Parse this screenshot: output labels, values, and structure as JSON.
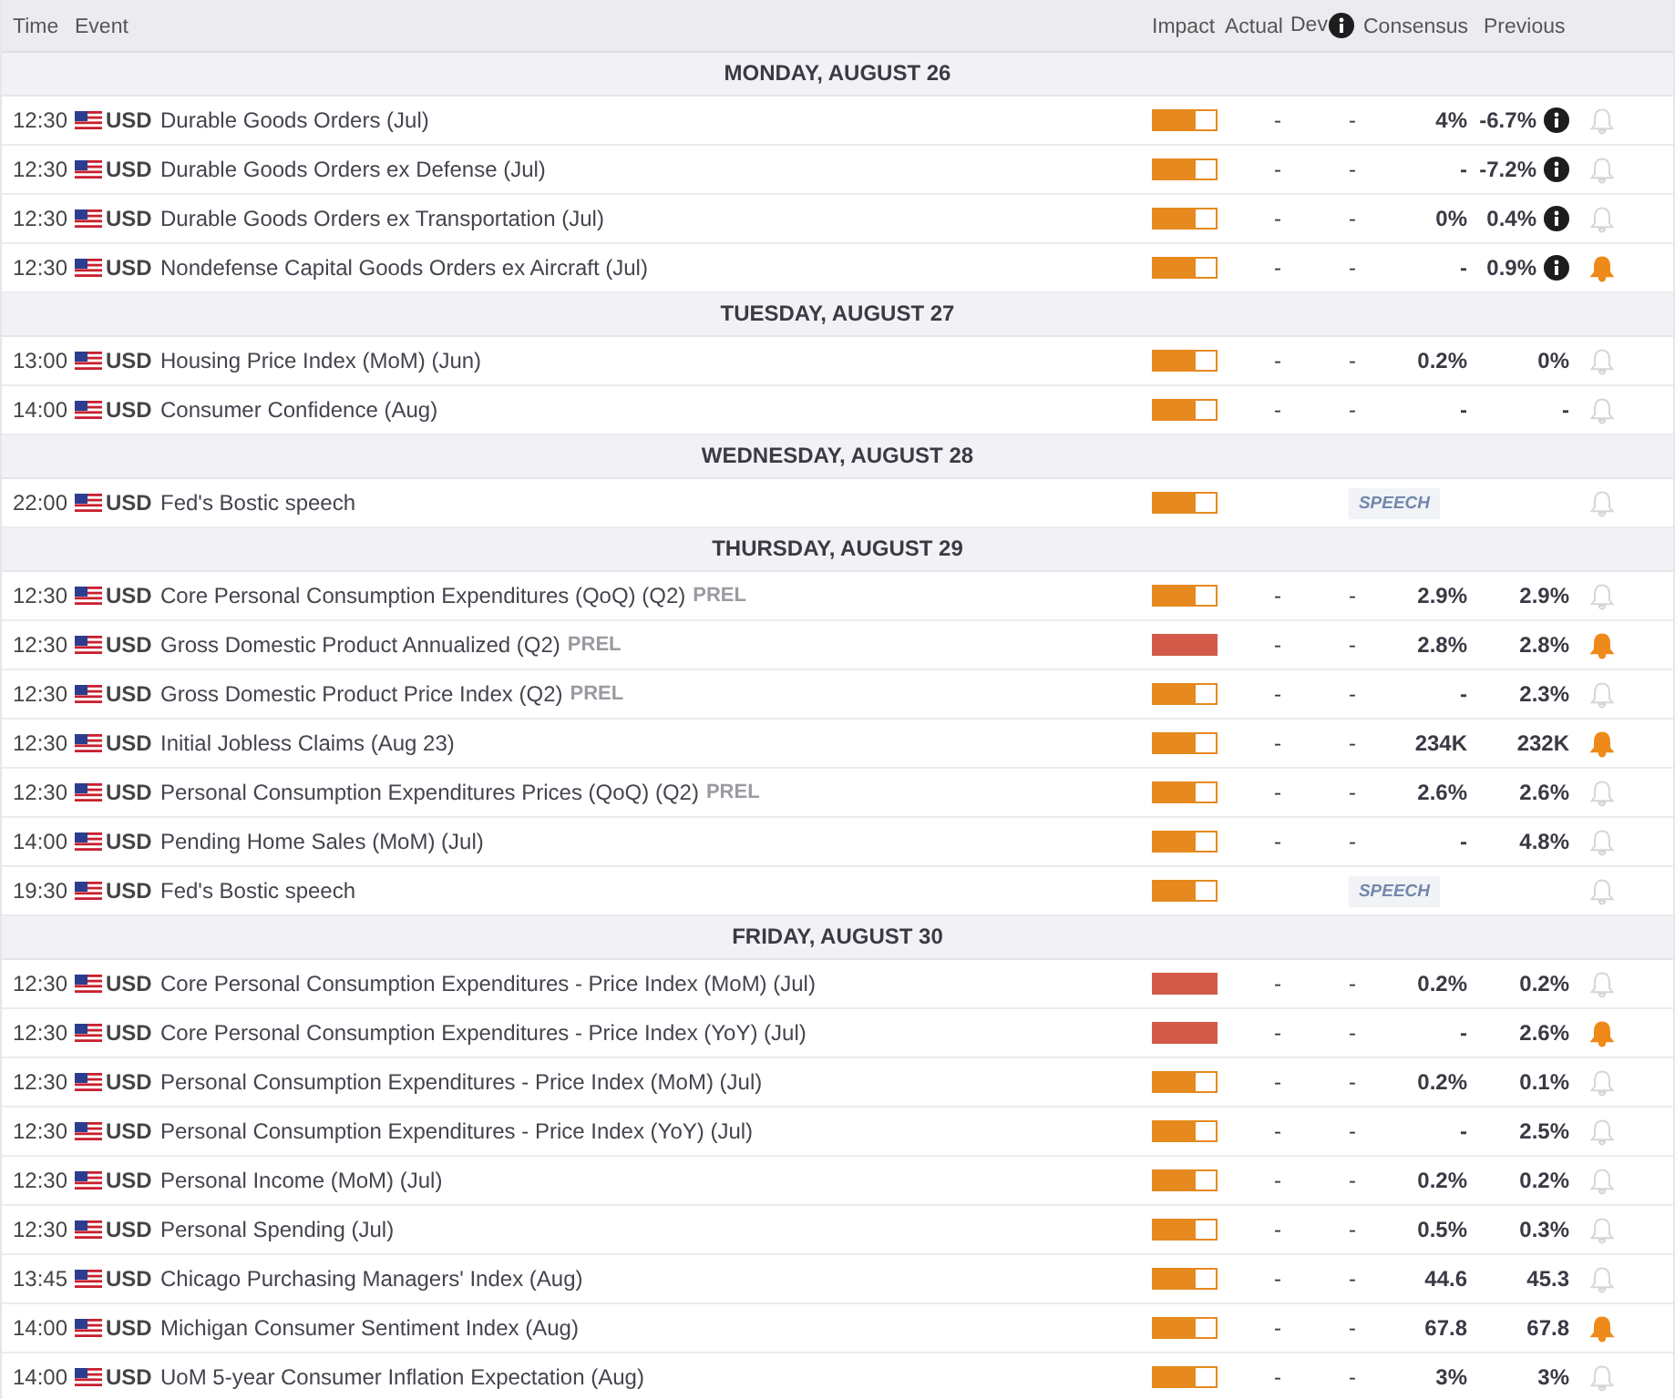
{
  "columns": {
    "time": "Time",
    "event": "Event",
    "impact": "Impact",
    "actual": "Actual",
    "dev": "Dev",
    "consensus": "Consensus",
    "previous": "Previous"
  },
  "days": [
    {
      "title": "MONDAY, AUGUST 26",
      "events": [
        {
          "time": "12:30",
          "currency": "USD",
          "name": "Durable Goods Orders (Jul)",
          "level": 0.67,
          "actual": "-",
          "dev": "-",
          "consensus": "4%",
          "previous": "-6.7%",
          "info": true,
          "alert": false
        },
        {
          "time": "12:30",
          "currency": "USD",
          "name": "Durable Goods Orders ex Defense (Jul)",
          "level": 0.67,
          "actual": "-",
          "dev": "-",
          "consensus": "-",
          "previous": "-7.2%",
          "info": true,
          "alert": false
        },
        {
          "time": "12:30",
          "currency": "USD",
          "name": "Durable Goods Orders ex Transportation (Jul)",
          "level": 0.67,
          "actual": "-",
          "dev": "-",
          "consensus": "0%",
          "previous": "0.4%",
          "info": true,
          "alert": false
        },
        {
          "time": "12:30",
          "currency": "USD",
          "name": "Nondefense Capital Goods Orders ex Aircraft (Jul)",
          "level": 0.67,
          "actual": "-",
          "dev": "-",
          "consensus": "-",
          "previous": "0.9%",
          "info": true,
          "alert": true
        }
      ]
    },
    {
      "title": "TUESDAY, AUGUST 27",
      "events": [
        {
          "time": "13:00",
          "currency": "USD",
          "name": "Housing Price Index (MoM) (Jun)",
          "level": 0.67,
          "actual": "-",
          "dev": "-",
          "consensus": "0.2%",
          "previous": "0%",
          "info": false,
          "alert": false
        },
        {
          "time": "14:00",
          "currency": "USD",
          "name": "Consumer Confidence (Aug)",
          "level": 0.67,
          "actual": "-",
          "dev": "-",
          "consensus": "-",
          "previous": "-",
          "info": false,
          "alert": false
        }
      ]
    },
    {
      "title": "WEDNESDAY, AUGUST 28",
      "events": [
        {
          "time": "22:00",
          "currency": "USD",
          "name": "Fed's Bostic speech",
          "level": 0.67,
          "badge": "SPEECH",
          "info": false,
          "alert": false
        }
      ]
    },
    {
      "title": "THURSDAY, AUGUST 29",
      "events": [
        {
          "time": "12:30",
          "currency": "USD",
          "name": "Core Personal Consumption Expenditures (QoQ) (Q2)",
          "tag": "PREL",
          "level": 0.67,
          "actual": "-",
          "dev": "-",
          "consensus": "2.9%",
          "previous": "2.9%",
          "info": false,
          "alert": false
        },
        {
          "time": "12:30",
          "currency": "USD",
          "name": "Gross Domestic Product Annualized (Q2)",
          "tag": "PREL",
          "level": 1,
          "actual": "-",
          "dev": "-",
          "consensus": "2.8%",
          "previous": "2.8%",
          "info": false,
          "alert": true
        },
        {
          "time": "12:30",
          "currency": "USD",
          "name": "Gross Domestic Product Price Index (Q2)",
          "tag": "PREL",
          "level": 0.67,
          "actual": "-",
          "dev": "-",
          "consensus": "-",
          "previous": "2.3%",
          "info": false,
          "alert": false
        },
        {
          "time": "12:30",
          "currency": "USD",
          "name": "Initial Jobless Claims (Aug 23)",
          "level": 0.67,
          "actual": "-",
          "dev": "-",
          "consensus": "234K",
          "previous": "232K",
          "info": false,
          "alert": true
        },
        {
          "time": "12:30",
          "currency": "USD",
          "name": "Personal Consumption Expenditures Prices (QoQ) (Q2)",
          "tag": "PREL",
          "level": 0.67,
          "actual": "-",
          "dev": "-",
          "consensus": "2.6%",
          "previous": "2.6%",
          "info": false,
          "alert": false
        },
        {
          "time": "14:00",
          "currency": "USD",
          "name": "Pending Home Sales (MoM) (Jul)",
          "level": 0.67,
          "actual": "-",
          "dev": "-",
          "consensus": "-",
          "previous": "4.8%",
          "info": false,
          "alert": false
        },
        {
          "time": "19:30",
          "currency": "USD",
          "name": "Fed's Bostic speech",
          "level": 0.67,
          "badge": "SPEECH",
          "info": false,
          "alert": false
        }
      ]
    },
    {
      "title": "FRIDAY, AUGUST 30",
      "events": [
        {
          "time": "12:30",
          "currency": "USD",
          "name": "Core Personal Consumption Expenditures - Price Index (MoM) (Jul)",
          "level": 1,
          "actual": "-",
          "dev": "-",
          "consensus": "0.2%",
          "previous": "0.2%",
          "info": false,
          "alert": false
        },
        {
          "time": "12:30",
          "currency": "USD",
          "name": "Core Personal Consumption Expenditures - Price Index (YoY) (Jul)",
          "level": 1,
          "actual": "-",
          "dev": "-",
          "consensus": "-",
          "previous": "2.6%",
          "info": false,
          "alert": true
        },
        {
          "time": "12:30",
          "currency": "USD",
          "name": "Personal Consumption Expenditures - Price Index (MoM) (Jul)",
          "level": 0.67,
          "actual": "-",
          "dev": "-",
          "consensus": "0.2%",
          "previous": "0.1%",
          "info": false,
          "alert": false
        },
        {
          "time": "12:30",
          "currency": "USD",
          "name": "Personal Consumption Expenditures - Price Index (YoY) (Jul)",
          "level": 0.67,
          "actual": "-",
          "dev": "-",
          "consensus": "-",
          "previous": "2.5%",
          "info": false,
          "alert": false
        },
        {
          "time": "12:30",
          "currency": "USD",
          "name": "Personal Income (MoM) (Jul)",
          "level": 0.67,
          "actual": "-",
          "dev": "-",
          "consensus": "0.2%",
          "previous": "0.2%",
          "info": false,
          "alert": false
        },
        {
          "time": "12:30",
          "currency": "USD",
          "name": "Personal Spending (Jul)",
          "level": 0.67,
          "actual": "-",
          "dev": "-",
          "consensus": "0.5%",
          "previous": "0.3%",
          "info": false,
          "alert": false
        },
        {
          "time": "13:45",
          "currency": "USD",
          "name": "Chicago Purchasing Managers' Index (Aug)",
          "level": 0.67,
          "actual": "-",
          "dev": "-",
          "consensus": "44.6",
          "previous": "45.3",
          "info": false,
          "alert": false
        },
        {
          "time": "14:00",
          "currency": "USD",
          "name": "Michigan Consumer Sentiment Index (Aug)",
          "level": 0.67,
          "actual": "-",
          "dev": "-",
          "consensus": "67.8",
          "previous": "67.8",
          "info": false,
          "alert": true
        },
        {
          "time": "14:00",
          "currency": "USD",
          "name": "UoM 5-year Consumer Inflation Expectation (Aug)",
          "level": 0.67,
          "actual": "-",
          "dev": "-",
          "consensus": "3%",
          "previous": "3%",
          "info": false,
          "alert": false
        }
      ]
    }
  ]
}
